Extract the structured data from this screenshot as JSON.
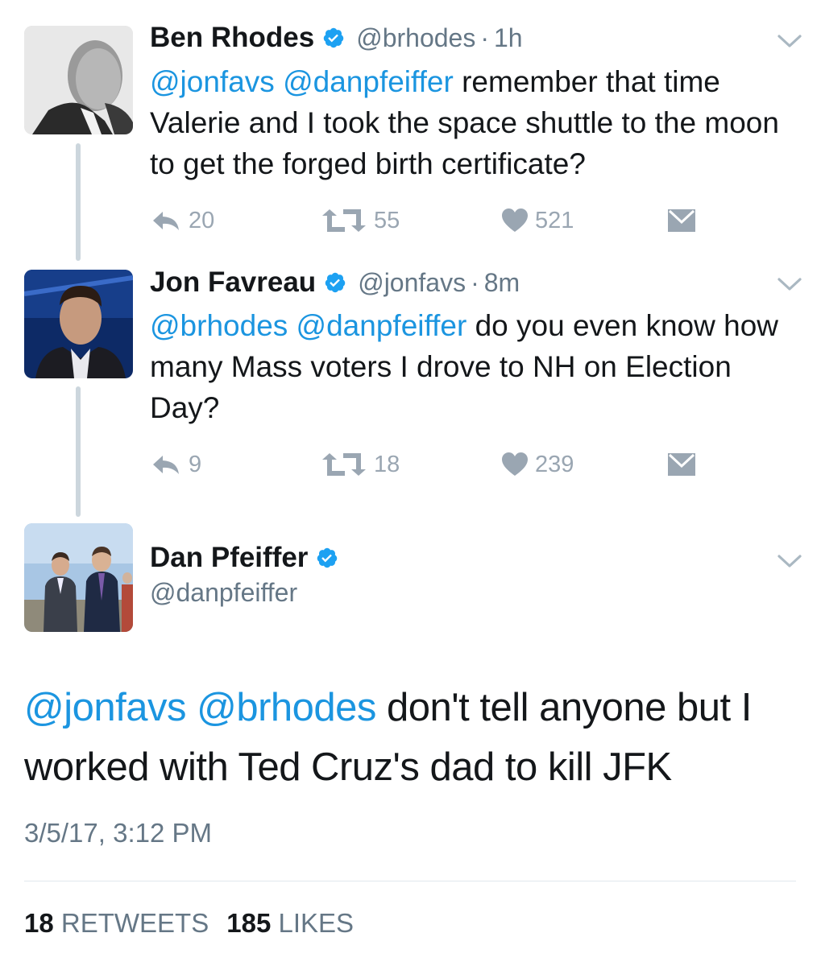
{
  "tweets": [
    {
      "name": "Ben Rhodes",
      "handle": "@brhodes",
      "separator": "·",
      "time": "1h",
      "mentions": "@jonfavs @danpfeiffer",
      "text_rest": " remember that time Valerie and I took the space shuttle to the moon to get the forged birth certificate?",
      "replies": "20",
      "retweets": "55",
      "likes": "521"
    },
    {
      "name": "Jon Favreau",
      "handle": "@jonfavs",
      "separator": "·",
      "time": "8m",
      "mentions": "@brhodes @danpfeiffer",
      "text_rest": " do you even know how many Mass voters I drove to NH on Election Day?",
      "replies": "9",
      "retweets": "18",
      "likes": "239"
    }
  ],
  "main_tweet": {
    "name": "Dan Pfeiffer",
    "handle": "@danpfeiffer",
    "mentions": "@jonfavs @brhodes",
    "text_rest": " don't tell anyone but I worked with Ted Cruz's dad to kill JFK",
    "timestamp": "3/5/17, 3:12 PM",
    "retweet_count": "18",
    "retweet_label": "RETWEETS",
    "like_count": "185",
    "like_label": "LIKES"
  },
  "colors": {
    "link": "#1b95e0",
    "secondary_text": "#657786",
    "action_icon": "#9aa6b2",
    "verified": "#1da1f2",
    "thread_line": "#ccd6dd"
  },
  "icons": [
    "verified-badge-icon",
    "chevron-down-icon",
    "reply-icon",
    "retweet-icon",
    "heart-icon",
    "direct-message-icon"
  ]
}
